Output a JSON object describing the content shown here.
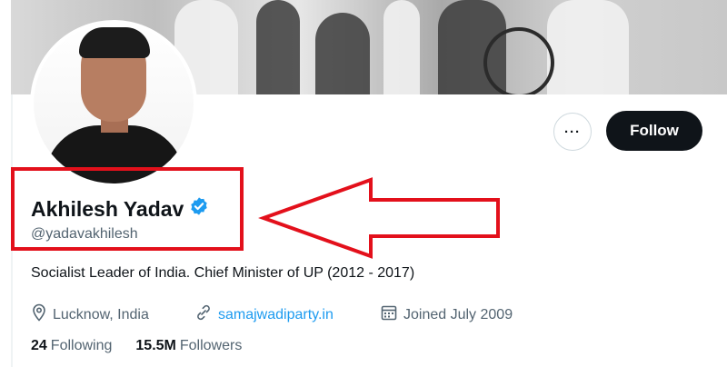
{
  "profile": {
    "name": "Akhilesh Yadav",
    "handle": "@yadavakhilesh",
    "bio": "Socialist Leader of India. Chief Minister of UP (2012 - 2017)",
    "location": "Lucknow, India",
    "website": "samajwadiparty.in",
    "joined": "Joined July 2009",
    "following_count": "24",
    "following_label": "Following",
    "followers_count": "15.5M",
    "followers_label": "Followers"
  },
  "actions": {
    "follow_label": "Follow",
    "more_label": "···"
  },
  "colors": {
    "verified": "#1d9bf0",
    "link": "#1d9bf0",
    "annotation": "#e3101b",
    "button_dark": "#0f1419"
  },
  "icons": {
    "verified": "verified-badge-icon",
    "location": "location-pin-icon",
    "website": "link-icon",
    "joined": "calendar-icon",
    "more": "more-dots-icon"
  }
}
